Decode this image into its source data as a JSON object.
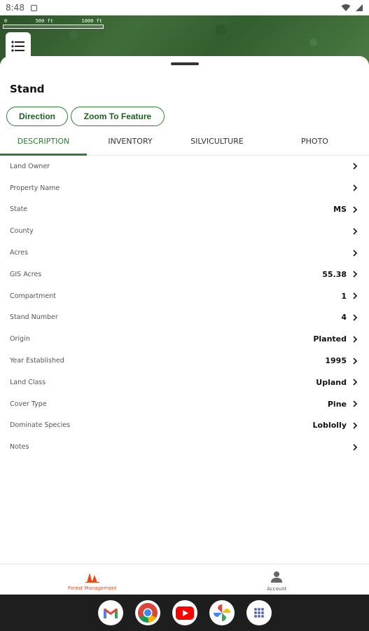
{
  "status_bar": {
    "time": "8:48"
  },
  "map": {
    "scale_labels": [
      "0",
      "500 ft",
      "1000 ft"
    ]
  },
  "sheet": {
    "title": "Stand",
    "buttons": {
      "direction": "Direction",
      "zoom": "Zoom To Feature"
    },
    "tabs": [
      "DESCRIPTION",
      "INVENTORY",
      "SILVICULTURE",
      "PHOTO"
    ],
    "active_tab": "DESCRIPTION",
    "rows": [
      {
        "label": "Land Owner",
        "value": ""
      },
      {
        "label": "Property Name",
        "value": ""
      },
      {
        "label": "State",
        "value": "MS"
      },
      {
        "label": "County",
        "value": ""
      },
      {
        "label": "Acres",
        "value": ""
      },
      {
        "label": "GIS Acres",
        "value": "55.38"
      },
      {
        "label": "Compartment",
        "value": "1"
      },
      {
        "label": "Stand Number",
        "value": "4"
      },
      {
        "label": "Origin",
        "value": "Planted"
      },
      {
        "label": "Year Established",
        "value": "1995"
      },
      {
        "label": "Land Class",
        "value": "Upland"
      },
      {
        "label": "Cover Type",
        "value": "Pine"
      },
      {
        "label": "Dominate Species",
        "value": "Loblolly"
      },
      {
        "label": "Notes",
        "value": ""
      }
    ]
  },
  "bottom_nav": {
    "forest": "Forest Management",
    "account": "Account"
  },
  "dock": [
    "gmail-icon",
    "chrome-icon",
    "youtube-icon",
    "photos-icon",
    "apps-icon"
  ],
  "colors": {
    "accent": "#2e7d32",
    "nav_active": "#e64a19"
  }
}
